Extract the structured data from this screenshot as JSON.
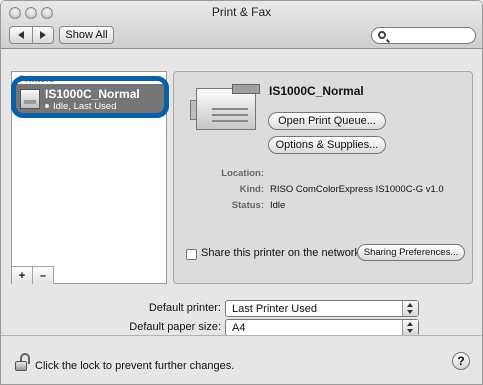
{
  "window": {
    "title": "Print & Fax"
  },
  "toolbar": {
    "show_all_label": "Show All",
    "search": {
      "placeholder": "",
      "value": ""
    }
  },
  "sidebar": {
    "header": "Printers",
    "items": [
      {
        "name": "IS1000C_Normal",
        "status": "Idle, Last Used",
        "selected": true
      }
    ],
    "add_label": "+",
    "remove_label": "–"
  },
  "detail": {
    "printer_name": "IS1000C_Normal",
    "open_queue_label": "Open Print Queue...",
    "options_supplies_label": "Options & Supplies...",
    "location_label": "Location:",
    "location_value": "",
    "kind_label": "Kind:",
    "kind_value": "RISO ComColorExpress IS1000C-G v1.0",
    "status_label": "Status:",
    "status_value": "Idle",
    "share_label": "Share this printer on the network",
    "share_checked": false,
    "sharing_prefs_label": "Sharing Preferences..."
  },
  "defaults": {
    "default_printer_label": "Default printer:",
    "default_printer_value": "Last Printer Used",
    "default_paper_label": "Default paper size:",
    "default_paper_value": "A4"
  },
  "footer": {
    "lock_text": "Click the lock to prevent further changes.",
    "help_label": "?"
  },
  "colors": {
    "highlight_ring": "#0a5fa6",
    "selection_bg": "#757575"
  }
}
